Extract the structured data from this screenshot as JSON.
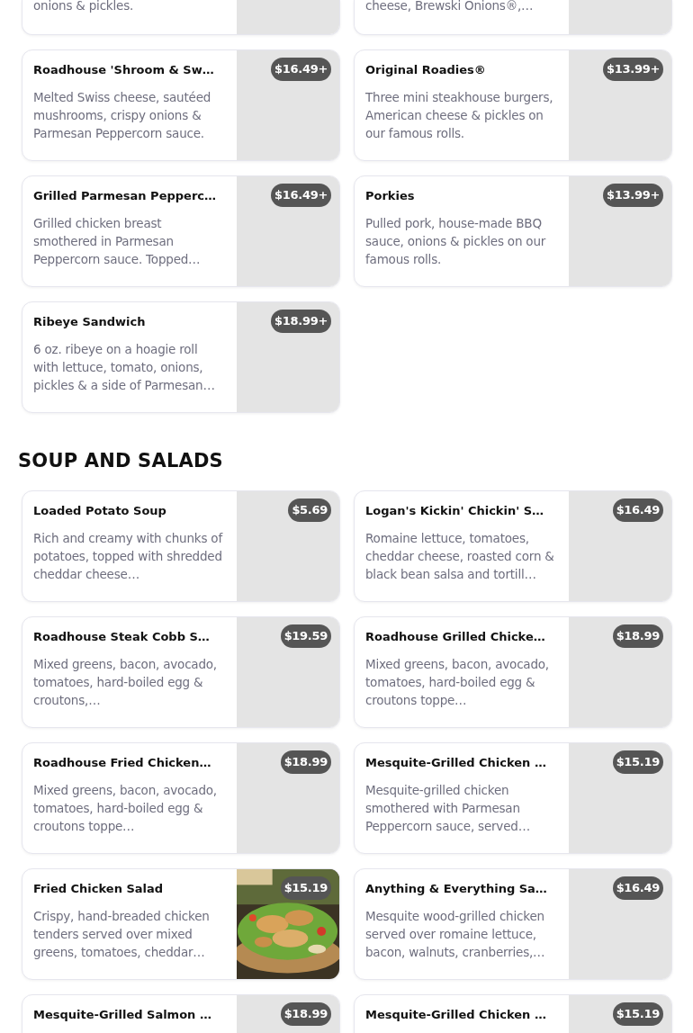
{
  "sections": [
    {
      "items": [
        {
          "description": "onions & pickles."
        },
        {
          "description": "cheese, Brewski Onions®,…"
        },
        {
          "name": "Roadhouse 'Shroom & Sw…",
          "price": "$16.49+",
          "description": "Melted Swiss cheese, sautéed mushrooms, crispy onions & Parmesan Peppercorn sauce."
        },
        {
          "name": "Original Roadies®",
          "price": "$13.99+",
          "description": "Three mini steakhouse burgers, American cheese & pickles on our famous rolls."
        },
        {
          "name": "Grilled Parmesan Pepperc…",
          "price": "$16.49+",
          "description": "Grilled chicken breast smothered in Parmesan Peppercorn sauce. Topped…"
        },
        {
          "name": "Porkies",
          "price": "$13.99+",
          "description": "Pulled pork, house-made BBQ sauce, onions & pickles on our famous rolls."
        },
        {
          "name": "Ribeye Sandwich",
          "price": "$18.99+",
          "description": "6 oz. ribeye on a hoagie roll with lettuce, tomato, onions, pickles & a side of Parmesan…"
        }
      ]
    },
    {
      "title": "SOUP AND SALADS",
      "items": [
        {
          "name": "Loaded Potato Soup",
          "price": "$5.69",
          "description": "Rich and creamy with chunks of potatoes, topped with shredded cheddar cheese…"
        },
        {
          "name": "Logan's Kickin' Chickin' S…",
          "price": "$16.49",
          "description": "Romaine lettuce, tomatoes, cheddar cheese, roasted corn & black bean salsa and tortill…"
        },
        {
          "name": "Roadhouse Steak Cobb S…",
          "price": "$19.59",
          "description": "Mixed greens, bacon, avocado, tomatoes, hard-boiled egg & croutons,…"
        },
        {
          "name": "Roadhouse Grilled Chicke…",
          "price": "$18.99",
          "description": "Mixed greens, bacon, avocado, tomatoes, hard-boiled egg & croutons toppe…"
        },
        {
          "name": "Roadhouse Fried Chicken…",
          "price": "$18.99",
          "description": "Mixed greens, bacon, avocado, tomatoes, hard-boiled egg & croutons toppe…"
        },
        {
          "name": "Mesquite-Grilled Chicken …",
          "price": "$15.19",
          "description": "Mesquite-grilled chicken smothered with Parmesan Peppercorn sauce, served…"
        },
        {
          "name": "Fried Chicken Salad",
          "price": "$15.19",
          "description": "Crispy, hand-breaded chicken tenders served over mixed greens, tomatoes, cheddar…"
        },
        {
          "name": "Anything & Everything Sa…",
          "price": "$16.49",
          "description": "Mesquite wood-grilled chicken served over romaine lettuce, bacon, walnuts, cranberries,…"
        },
        {
          "name": "Mesquite-Grilled Salmon …",
          "price": "$18.99"
        },
        {
          "name": "Mesquite-Grilled Chicken …",
          "price": "$15.19"
        }
      ]
    }
  ]
}
